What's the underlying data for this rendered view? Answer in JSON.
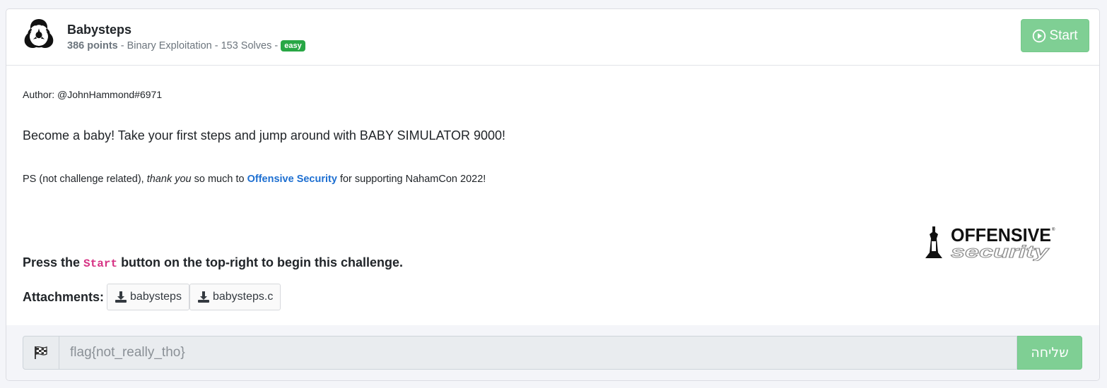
{
  "challenge": {
    "title": "Babysteps",
    "points": "386 points",
    "category_solves": " - Binary Exploitation - 153 Solves - ",
    "difficulty": "easy",
    "start_label": "Start"
  },
  "description": {
    "author": "Author: @JohnHammond#6971",
    "blurb": "Become a baby! Take your first steps and jump around with BABY SIMULATOR 9000!",
    "ps_prefix": "PS (not challenge related), ",
    "ps_em": "thank you",
    "ps_mid": " so much to ",
    "ps_link": "Offensive Security",
    "ps_suffix": " for supporting NahamCon 2022!",
    "logo_line1": "OFFENSIVE",
    "logo_line2": "security",
    "press_prefix": "Press the ",
    "press_code": "Start",
    "press_suffix": " button on the top-right to begin this challenge.",
    "attachments_label": "Attachments:",
    "attachments": [
      {
        "name": "babysteps"
      },
      {
        "name": "babysteps.c"
      }
    ]
  },
  "flag_form": {
    "value": "",
    "placeholder": "flag{not_really_tho}",
    "submit_label": "שליחה"
  },
  "colors": {
    "accent_green": "#7fcf94",
    "badge_green": "#28a745",
    "link_blue": "#1d6fd1",
    "code_pink": "#d63384"
  },
  "icons": [
    "biohazard-icon",
    "play-circle-icon",
    "download-icon",
    "checkered-flag-icon",
    "offensive-security-logo"
  ]
}
